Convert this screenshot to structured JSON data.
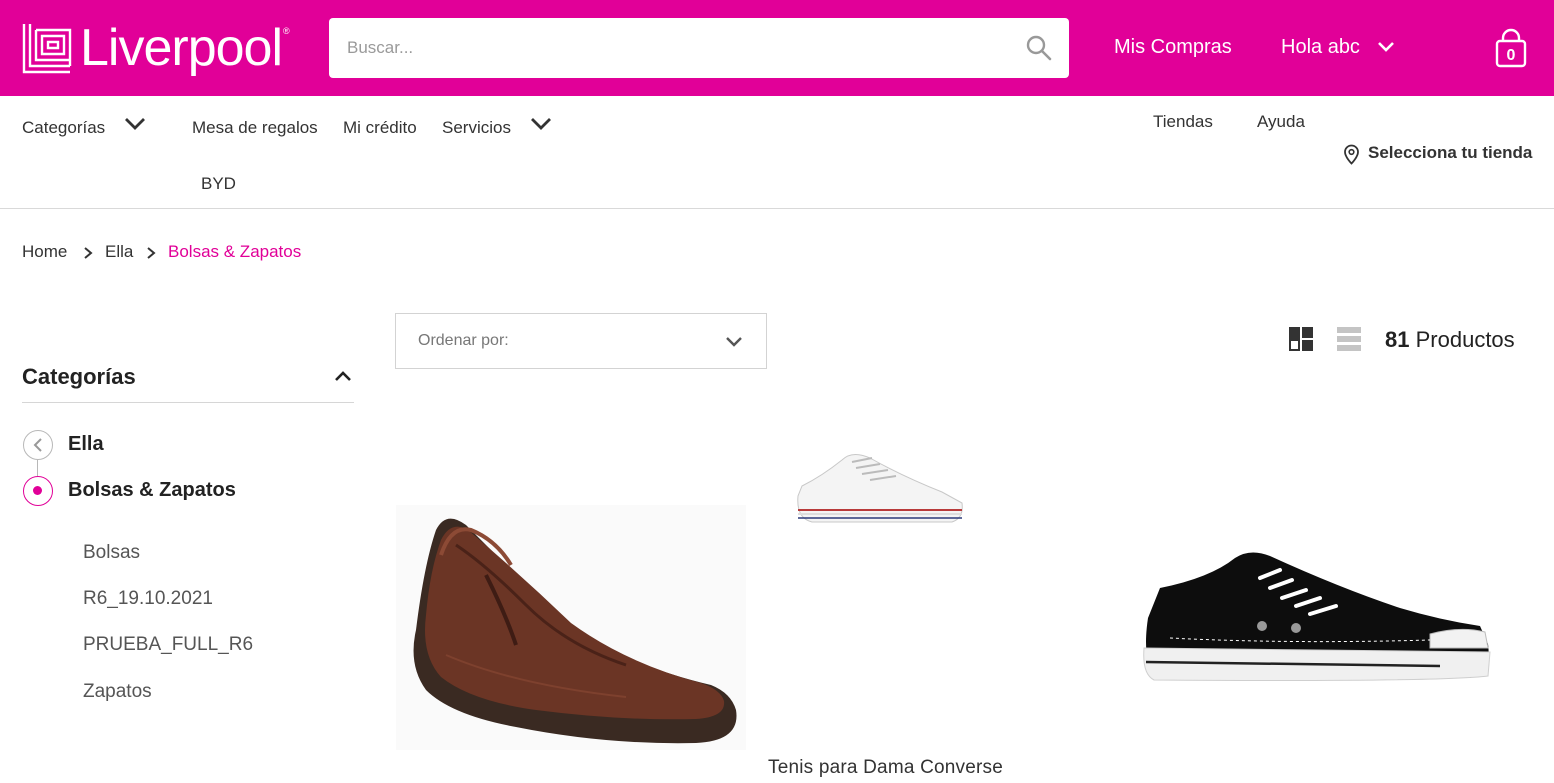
{
  "brand": {
    "name": "Liverpool",
    "reg_mark": "®",
    "color": "#e10098"
  },
  "search": {
    "placeholder": "Buscar...",
    "icon": "search-icon"
  },
  "header": {
    "my_purchases": "Mis Compras",
    "greeting": "Hola abc",
    "cart_count": "0"
  },
  "nav": {
    "categories": "Categorías",
    "gift_registry": "Mesa de regalos",
    "credit": "Mi crédito",
    "services": "Servicios",
    "byd": "BYD",
    "stores": "Tiendas",
    "help": "Ayuda",
    "select_store": "Selecciona tu tienda"
  },
  "breadcrumb": [
    "Home",
    "Ella",
    "Bolsas & Zapatos"
  ],
  "sidebar": {
    "title": "Categorías",
    "parent": "Ella",
    "current": "Bolsas & Zapatos",
    "subcategories": [
      "Bolsas",
      "R6_19.10.2021",
      "PRUEBA_FULL_R6",
      "Zapatos"
    ]
  },
  "toolbar": {
    "sort_label": "Ordenar por:",
    "product_count": "81",
    "product_count_label": "Productos"
  },
  "products": [
    {
      "name": "",
      "image": "brown-leather-slip-on-shoe"
    },
    {
      "name": "Tenis para Dama Converse",
      "image": "white-converse-sneaker"
    },
    {
      "name": "",
      "image": "black-converse-sneaker"
    }
  ]
}
